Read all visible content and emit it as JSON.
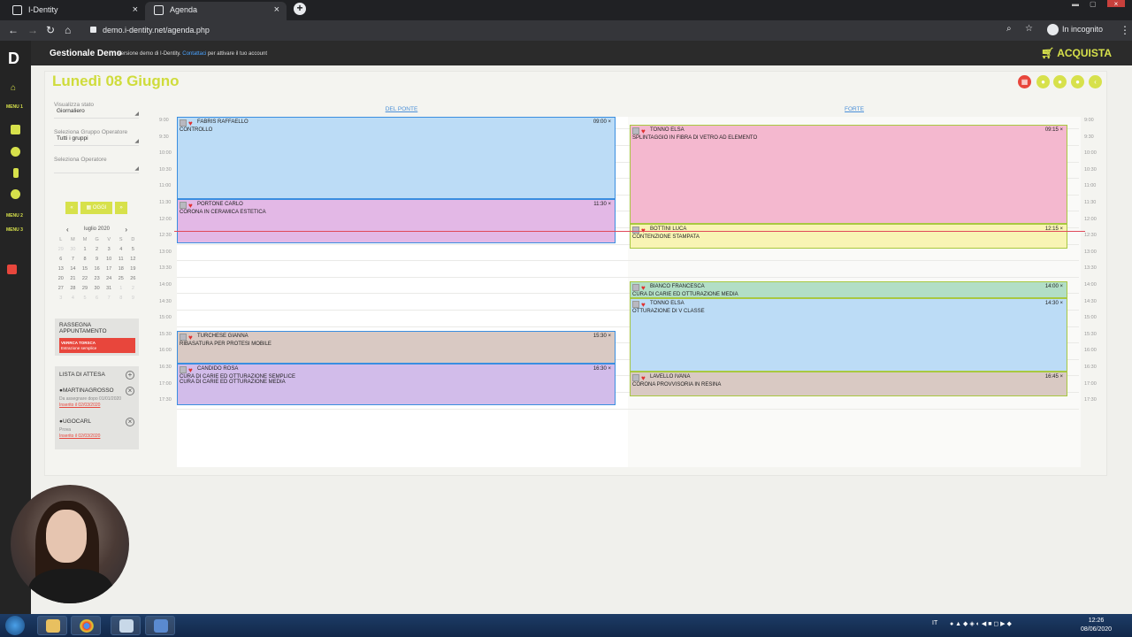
{
  "browser": {
    "tabs": [
      {
        "label": "I-Dentity"
      },
      {
        "label": "Agenda"
      }
    ],
    "url": "demo.i-dentity.net/agenda.php",
    "incognito_label": "In incognito"
  },
  "header": {
    "title": "Gestionale Demo",
    "subtitle_pre": "Versione demo di I-Dentity.",
    "subtitle_link": "Contattaci",
    "subtitle_post": "per attivare il tuo account",
    "buy_label": "ACQUISTA"
  },
  "leftnav": {
    "menu1": "MENU 1",
    "menu2": "MENU 2",
    "menu3": "MENU 3"
  },
  "page": {
    "date_title": "Lunedì 08 Giugno"
  },
  "sidepanel": {
    "view_label": "Visualizza stato",
    "view_value": "Giornaliero",
    "group_label": "Seleziona Gruppo Operatore",
    "group_value": "Tutti i gruppi",
    "operator_label": "Seleziona Operatore",
    "today_label": "OGGI",
    "prev_label": "«",
    "next_label": "»"
  },
  "calendar": {
    "month_label": "luglio 2020",
    "weekdays": [
      "L",
      "M",
      "M",
      "G",
      "V",
      "S",
      "D"
    ],
    "weeks": [
      [
        "29",
        "30",
        "1",
        "2",
        "3",
        "4",
        "5"
      ],
      [
        "6",
        "7",
        "8",
        "9",
        "10",
        "11",
        "12"
      ],
      [
        "13",
        "14",
        "15",
        "16",
        "17",
        "18",
        "19"
      ],
      [
        "20",
        "21",
        "22",
        "23",
        "24",
        "25",
        "26"
      ],
      [
        "27",
        "28",
        "29",
        "30",
        "31",
        "1",
        "2"
      ],
      [
        "3",
        "4",
        "5",
        "6",
        "7",
        "8",
        "9"
      ]
    ]
  },
  "rassegna": {
    "title": "RASSEGNA APPUNTAMENTO",
    "item_name": "VERRCA TORSCA",
    "item_desc": "Estrazione semplice"
  },
  "lista_attesa": {
    "title": "LISTA DI ATTESA",
    "items": [
      {
        "name": "MARTINAGROSSO",
        "note": "Da assegnare dopo 01/01/2020",
        "inserted": "Inserito il 02/03/2020"
      },
      {
        "name": "UGOCARL",
        "note": "Prova",
        "inserted": "Inserito il 02/03/2020"
      }
    ]
  },
  "agenda": {
    "columns": [
      "DEL PONTE",
      "FORTE"
    ],
    "times": [
      "9:00",
      "9:30",
      "10:00",
      "10:30",
      "11:00",
      "11:30",
      "12:00",
      "12:30",
      "13:00",
      "13:30",
      "14:00",
      "14:30",
      "15:00",
      "15:30",
      "16:00",
      "16:30",
      "17:00",
      "17:30"
    ],
    "appointments": [
      {
        "col": 0,
        "name": "FABRIS RAFFAELLO",
        "time": "09:00",
        "desc": "CONTROLLO",
        "color": "#bcdcf6",
        "border": "#3a8ee0"
      },
      {
        "col": 0,
        "name": "PORTONE CARLO",
        "time": "11:30",
        "desc": "CORONA IN CERAMICA ESTETICA",
        "color": "#e3b8e6",
        "border": "#3a8ee0"
      },
      {
        "col": 0,
        "name": "TURCHESE GIANNA",
        "time": "15:30",
        "desc": "RIBASATURA PER PROTESI MOBILE",
        "color": "#d9c9c3",
        "border": "#3a8ee0"
      },
      {
        "col": 0,
        "name": "CANDIDO ROSA",
        "time": "16:30",
        "desc": "CURA DI CARIE ED OTTURAZIONE SEMPLICE\nCURA DI CARIE ED OTTURAZIONE MEDIA",
        "color": "#d2bcea",
        "border": "#3a8ee0"
      },
      {
        "col": 1,
        "name": "TONNO ELSA",
        "time": "09:15",
        "desc": "SPLINTAGGIO IN FIBRA DI VETRO AD ELEMENTO",
        "color": "#f4b8cf",
        "border": "#a8c840"
      },
      {
        "col": 1,
        "name": "BOTTINI LUCA",
        "time": "12:15",
        "desc": "CONTENZIONE STAMPATA",
        "color": "#f8f4b4",
        "border": "#a8c840"
      },
      {
        "col": 1,
        "name": "BIANCO FRANCESCA",
        "time": "14:00",
        "desc": "CURA DI CARIE ED OTTURAZIONE MEDIA",
        "color": "#b2dec6",
        "border": "#a8c840"
      },
      {
        "col": 1,
        "name": "TONNO ELSA",
        "time": "14:30",
        "desc": "OTTURAZIONE DI V CLASSE",
        "color": "#bcdcf6",
        "border": "#a8c840"
      },
      {
        "col": 1,
        "name": "LAVELLO IVANA",
        "time": "16:45",
        "desc": "CORONA PROVVISORIA IN RESINA",
        "color": "#d9c9c3",
        "border": "#a8c840"
      }
    ]
  },
  "taskbar": {
    "lang": "IT",
    "time": "12:26",
    "date": "08/06/2020"
  }
}
